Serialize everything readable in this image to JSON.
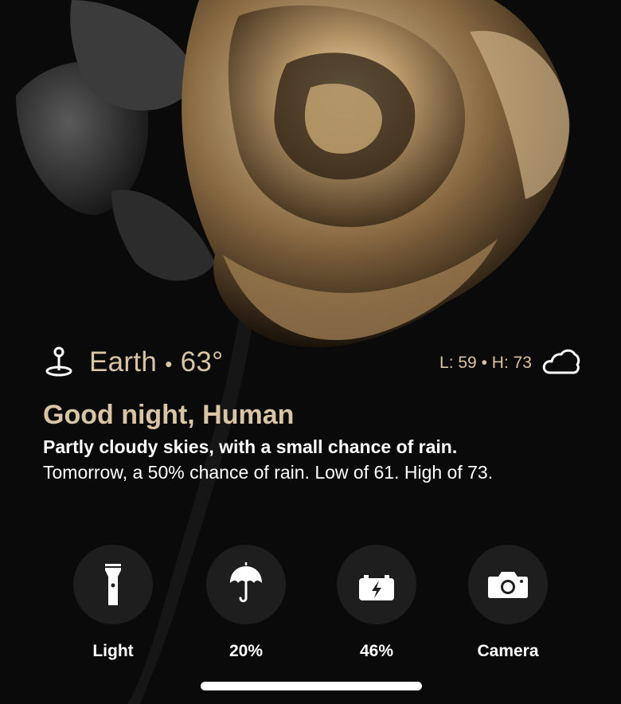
{
  "weather": {
    "location": "Earth",
    "temperature": "63°",
    "separator": "•",
    "low": "L: 59",
    "high": "H: 73",
    "condition_icon": "cloud-icon",
    "location_icon": "map-pin-icon"
  },
  "greeting": {
    "title": "Good night, Human",
    "summary": "Partly cloudy skies, with a small chance of rain.",
    "forecast": "Tomorrow, a 50% chance of rain. Low of 61. High of 73."
  },
  "shortcuts": [
    {
      "label": "Light",
      "icon": "flashlight-icon"
    },
    {
      "label": "20%",
      "icon": "umbrella-icon"
    },
    {
      "label": "46%",
      "icon": "battery-charging-icon"
    },
    {
      "label": "Camera",
      "icon": "camera-icon"
    }
  ],
  "colors": {
    "accent": "#d9c4a4",
    "background": "#0a0a0a",
    "button": "#1e1e1e",
    "text": "#ffffff"
  }
}
